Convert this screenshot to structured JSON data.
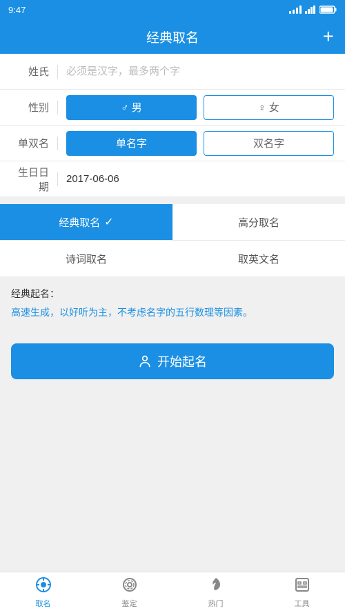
{
  "statusBar": {
    "time": "9:47",
    "signalText": "....ll",
    "batteryText": "□"
  },
  "header": {
    "title": "经典取名",
    "addLabel": "+"
  },
  "form": {
    "surnameLabel": "姓氏",
    "surnamePlaceholder": "必须是汉字，最多两个字",
    "genderLabel": "性别",
    "genderMale": "♂ 男",
    "genderFemale": "♀ 女",
    "nameTypeLabel": "单双名",
    "nameSingle": "单名字",
    "nameDouble": "双名字",
    "birthdayLabel": "生日日期",
    "birthdayValue": "2017-06-06"
  },
  "namingTypes": {
    "classic": "经典取名",
    "highScore": "高分取名",
    "poetry": "诗词取名",
    "english": "取英文名"
  },
  "description": {
    "title": "经典起名：",
    "content": "高速生成，以好听为主，不考虑名字的五行数理等因素。"
  },
  "startButton": {
    "label": "开始起名",
    "icon": "👤"
  },
  "bottomNav": {
    "items": [
      {
        "label": "取名",
        "active": true
      },
      {
        "label": "鉴定",
        "active": false
      },
      {
        "label": "热门",
        "active": false
      },
      {
        "label": "工具",
        "active": false
      }
    ]
  }
}
